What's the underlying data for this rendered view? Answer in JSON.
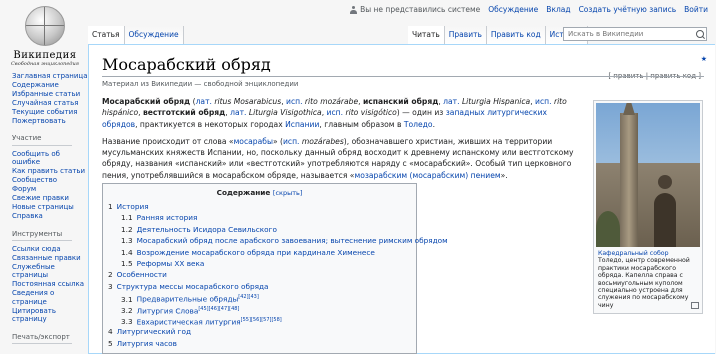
{
  "logo": {
    "wordmark": "Википедия",
    "tagline": "Свободная энциклопедия"
  },
  "personal": {
    "anon": "Вы не представились системе",
    "links": [
      "Обсуждение",
      "Вклад",
      "Создать учётную запись",
      "Войти"
    ]
  },
  "left_tabs": [
    {
      "label": "Статья",
      "selected": true
    },
    {
      "label": "Обсуждение",
      "selected": false
    }
  ],
  "right_tabs": [
    {
      "label": "Читать",
      "selected": true
    },
    {
      "label": "Править",
      "selected": false
    },
    {
      "label": "Править код",
      "selected": false
    },
    {
      "label": "История",
      "selected": false
    }
  ],
  "search": {
    "placeholder": "Искать в Википедии"
  },
  "sidebar": {
    "main": [
      "Заглавная страница",
      "Содержание",
      "Избранные статьи",
      "Случайная статья",
      "Текущие события",
      "Пожертвовать"
    ],
    "participation_title": "Участие",
    "participation": [
      "Сообщить об ошибке",
      "Как править статьи",
      "Сообщество",
      "Форум",
      "Свежие правки",
      "Новые страницы",
      "Справка"
    ],
    "tools_title": "Инструменты",
    "tools": [
      "Ссылки сюда",
      "Связанные правки",
      "Служебные страницы",
      "Постоянная ссылка",
      "Сведения о странице",
      "Цитировать страницу"
    ],
    "export_title": "Печать/экспорт"
  },
  "page": {
    "title": "Мосарабский обряд",
    "edit_links": "[ править | править код ]",
    "star": "★",
    "tagline": "Материал из Википедии — свободной энциклопедии"
  },
  "intro": {
    "p1": {
      "b1": "Мосарабский обряд",
      "t1": " (",
      "l1": "лат.",
      "i1": " ritus Mosarabicus",
      "t2": ", ",
      "l2": "исп.",
      "i2": " rito mozárabe",
      "t3": ", ",
      "b2": "испанский обряд",
      "t4": ", ",
      "l3": "лат.",
      "i3": " Liturgia Hispanica",
      "t5": ", ",
      "l4": "исп.",
      "i4": " rito hispánico",
      "t6": ", ",
      "b3": "вестготский обряд",
      "t7": ", ",
      "l5": "лат.",
      "i5": " Liturgia Visigothica",
      "t8": ", ",
      "l6": "исп.",
      "i6": " rito visigótico",
      "t9": ") — один из ",
      "l7": "западных литургических обрядов",
      "t10": ", практикуется в некоторых городах ",
      "l8": "Испании",
      "t11": ", главным образом в ",
      "l9": "Толедо",
      "t12": "."
    },
    "p2": {
      "t1": "Название происходит от слова «",
      "l1": "мосарабы",
      "t2": "» (",
      "l2": "исп.",
      "i1": " mozárabes",
      "t3": "), обозначавшего христиан, живших на территории мусульманских княжеств Испании, но, поскольку данный обряд восходит к древнему испанскому или вестготскому обряду, названия «испанский» или «вестготский» употребляются наряду с «мосарабский». Особый тип церковного пения, употреблявшийся в мосарабском обряде, называется «",
      "l3": "мозарабским (мосарабским) пением",
      "t4": "»."
    }
  },
  "toc": {
    "title": "Содержание",
    "toggle": "[скрыть]",
    "items": [
      {
        "num": "1",
        "text": "История",
        "level": 1
      },
      {
        "num": "1.1",
        "text": "Ранняя история",
        "level": 2
      },
      {
        "num": "1.2",
        "text": "Деятельность Исидора Севильского",
        "level": 2
      },
      {
        "num": "1.3",
        "text": "Мосарабский обряд после арабского завоевания; вытеснение римским обрядом",
        "level": 2
      },
      {
        "num": "1.4",
        "text": "Возрождение мосарабского обряда при кардинале Хименесе",
        "level": 2
      },
      {
        "num": "1.5",
        "text": "Реформы XX века",
        "level": 2
      },
      {
        "num": "2",
        "text": "Особенности",
        "level": 1
      },
      {
        "num": "3",
        "text": "Структура мессы мосарабского обряда",
        "level": 1
      },
      {
        "num": "3.1",
        "text": "Предварительные обряды",
        "sup": "[42][43]",
        "level": 2
      },
      {
        "num": "3.2",
        "text": "Литургия Слова",
        "sup": "[45][46][47][48]",
        "level": 2
      },
      {
        "num": "3.3",
        "text": "Евхаристическая литургия",
        "sup": "[55][56][57][58]",
        "level": 2
      },
      {
        "num": "4",
        "text": "Литургический год",
        "level": 1
      },
      {
        "num": "5",
        "text": "Литургия часов",
        "level": 1
      }
    ]
  },
  "infobox": {
    "caption_title": "Кафедральный собор",
    "caption_text": "Толедо, центр современной практики мосарабского обряда. Капелла справа с восьмиугольным куполом специально устроена для служения по мосарабскому чину"
  }
}
